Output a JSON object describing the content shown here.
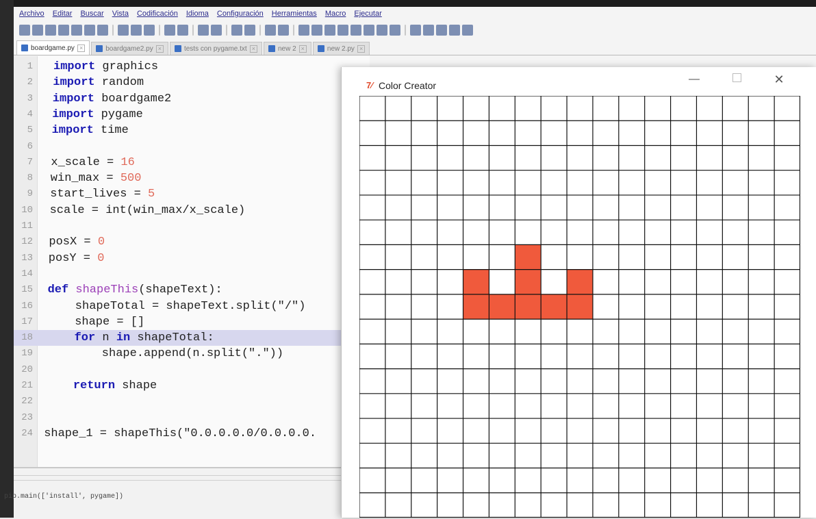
{
  "menu": [
    "Archivo",
    "Editar",
    "Buscar",
    "Vista",
    "Codificación",
    "Idioma",
    "Configuración",
    "Herramientas",
    "Macro",
    "Ejecutar"
  ],
  "tabs": [
    {
      "label": "boardgame.py",
      "active": true
    },
    {
      "label": "boardgame2.py",
      "active": false
    },
    {
      "label": "tests con pygame.txt",
      "active": false
    },
    {
      "label": "new 2",
      "active": false
    },
    {
      "label": "new 2.py",
      "active": false
    }
  ],
  "code": [
    {
      "n": "1",
      "text": "import graphics"
    },
    {
      "n": "2",
      "text": "import random"
    },
    {
      "n": "3",
      "text": "import boardgame2"
    },
    {
      "n": "4",
      "text": "import pygame"
    },
    {
      "n": "5",
      "text": "import time"
    },
    {
      "n": "6",
      "text": ""
    },
    {
      "n": "7",
      "text": "x_scale = 16"
    },
    {
      "n": "8",
      "text": "win_max = 500"
    },
    {
      "n": "9",
      "text": "start_lives = 5"
    },
    {
      "n": "10",
      "text": "scale = int(win_max/x_scale)"
    },
    {
      "n": "11",
      "text": ""
    },
    {
      "n": "12",
      "text": "posX = 0"
    },
    {
      "n": "13",
      "text": "posY = 0"
    },
    {
      "n": "14",
      "text": ""
    },
    {
      "n": "15",
      "text": "def shapeThis(shapeText):"
    },
    {
      "n": "16",
      "text": "    shapeTotal = shapeText.split(\"/\")"
    },
    {
      "n": "17",
      "text": "    shape = []"
    },
    {
      "n": "18",
      "text": "    for n in shapeTotal:"
    },
    {
      "n": "19",
      "text": "        shape.append(n.split(\".\"))"
    },
    {
      "n": "20",
      "text": ""
    },
    {
      "n": "21",
      "text": "    return shape"
    },
    {
      "n": "22",
      "text": ""
    },
    {
      "n": "23",
      "text": ""
    },
    {
      "n": "24",
      "text": "shape_1 = shapeThis(\"0.0.0.0.0/0.0.0.0."
    }
  ],
  "console_text": "pip.main(['install', pygame])",
  "window": {
    "title": "Color Creator",
    "icon": "tk-feather-icon",
    "minimize": "—",
    "close": "✕"
  },
  "grid": {
    "cols": 17,
    "rows": 17,
    "fill_color": "#f05a3c",
    "line_color": "#111111",
    "filled_cells": [
      [
        6,
        6
      ],
      [
        4,
        7
      ],
      [
        6,
        7
      ],
      [
        8,
        7
      ],
      [
        4,
        8
      ],
      [
        5,
        8
      ],
      [
        6,
        8
      ],
      [
        7,
        8
      ],
      [
        8,
        8
      ]
    ]
  }
}
